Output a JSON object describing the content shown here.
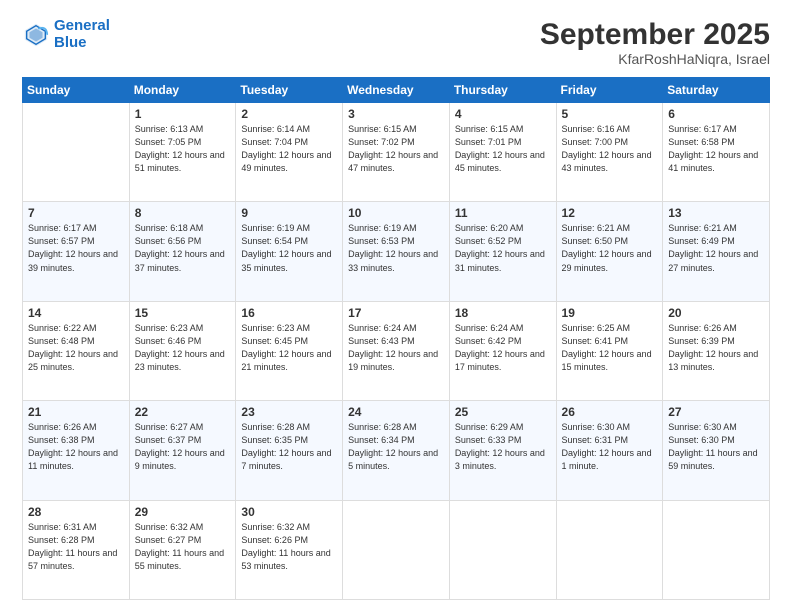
{
  "header": {
    "logo_line1": "General",
    "logo_line2": "Blue",
    "month": "September 2025",
    "location": "KfarRoshHaNiqra, Israel"
  },
  "weekdays": [
    "Sunday",
    "Monday",
    "Tuesday",
    "Wednesday",
    "Thursday",
    "Friday",
    "Saturday"
  ],
  "weeks": [
    [
      {
        "day": "",
        "sunrise": "",
        "sunset": "",
        "daylight": ""
      },
      {
        "day": "1",
        "sunrise": "Sunrise: 6:13 AM",
        "sunset": "Sunset: 7:05 PM",
        "daylight": "Daylight: 12 hours and 51 minutes."
      },
      {
        "day": "2",
        "sunrise": "Sunrise: 6:14 AM",
        "sunset": "Sunset: 7:04 PM",
        "daylight": "Daylight: 12 hours and 49 minutes."
      },
      {
        "day": "3",
        "sunrise": "Sunrise: 6:15 AM",
        "sunset": "Sunset: 7:02 PM",
        "daylight": "Daylight: 12 hours and 47 minutes."
      },
      {
        "day": "4",
        "sunrise": "Sunrise: 6:15 AM",
        "sunset": "Sunset: 7:01 PM",
        "daylight": "Daylight: 12 hours and 45 minutes."
      },
      {
        "day": "5",
        "sunrise": "Sunrise: 6:16 AM",
        "sunset": "Sunset: 7:00 PM",
        "daylight": "Daylight: 12 hours and 43 minutes."
      },
      {
        "day": "6",
        "sunrise": "Sunrise: 6:17 AM",
        "sunset": "Sunset: 6:58 PM",
        "daylight": "Daylight: 12 hours and 41 minutes."
      }
    ],
    [
      {
        "day": "7",
        "sunrise": "Sunrise: 6:17 AM",
        "sunset": "Sunset: 6:57 PM",
        "daylight": "Daylight: 12 hours and 39 minutes."
      },
      {
        "day": "8",
        "sunrise": "Sunrise: 6:18 AM",
        "sunset": "Sunset: 6:56 PM",
        "daylight": "Daylight: 12 hours and 37 minutes."
      },
      {
        "day": "9",
        "sunrise": "Sunrise: 6:19 AM",
        "sunset": "Sunset: 6:54 PM",
        "daylight": "Daylight: 12 hours and 35 minutes."
      },
      {
        "day": "10",
        "sunrise": "Sunrise: 6:19 AM",
        "sunset": "Sunset: 6:53 PM",
        "daylight": "Daylight: 12 hours and 33 minutes."
      },
      {
        "day": "11",
        "sunrise": "Sunrise: 6:20 AM",
        "sunset": "Sunset: 6:52 PM",
        "daylight": "Daylight: 12 hours and 31 minutes."
      },
      {
        "day": "12",
        "sunrise": "Sunrise: 6:21 AM",
        "sunset": "Sunset: 6:50 PM",
        "daylight": "Daylight: 12 hours and 29 minutes."
      },
      {
        "day": "13",
        "sunrise": "Sunrise: 6:21 AM",
        "sunset": "Sunset: 6:49 PM",
        "daylight": "Daylight: 12 hours and 27 minutes."
      }
    ],
    [
      {
        "day": "14",
        "sunrise": "Sunrise: 6:22 AM",
        "sunset": "Sunset: 6:48 PM",
        "daylight": "Daylight: 12 hours and 25 minutes."
      },
      {
        "day": "15",
        "sunrise": "Sunrise: 6:23 AM",
        "sunset": "Sunset: 6:46 PM",
        "daylight": "Daylight: 12 hours and 23 minutes."
      },
      {
        "day": "16",
        "sunrise": "Sunrise: 6:23 AM",
        "sunset": "Sunset: 6:45 PM",
        "daylight": "Daylight: 12 hours and 21 minutes."
      },
      {
        "day": "17",
        "sunrise": "Sunrise: 6:24 AM",
        "sunset": "Sunset: 6:43 PM",
        "daylight": "Daylight: 12 hours and 19 minutes."
      },
      {
        "day": "18",
        "sunrise": "Sunrise: 6:24 AM",
        "sunset": "Sunset: 6:42 PM",
        "daylight": "Daylight: 12 hours and 17 minutes."
      },
      {
        "day": "19",
        "sunrise": "Sunrise: 6:25 AM",
        "sunset": "Sunset: 6:41 PM",
        "daylight": "Daylight: 12 hours and 15 minutes."
      },
      {
        "day": "20",
        "sunrise": "Sunrise: 6:26 AM",
        "sunset": "Sunset: 6:39 PM",
        "daylight": "Daylight: 12 hours and 13 minutes."
      }
    ],
    [
      {
        "day": "21",
        "sunrise": "Sunrise: 6:26 AM",
        "sunset": "Sunset: 6:38 PM",
        "daylight": "Daylight: 12 hours and 11 minutes."
      },
      {
        "day": "22",
        "sunrise": "Sunrise: 6:27 AM",
        "sunset": "Sunset: 6:37 PM",
        "daylight": "Daylight: 12 hours and 9 minutes."
      },
      {
        "day": "23",
        "sunrise": "Sunrise: 6:28 AM",
        "sunset": "Sunset: 6:35 PM",
        "daylight": "Daylight: 12 hours and 7 minutes."
      },
      {
        "day": "24",
        "sunrise": "Sunrise: 6:28 AM",
        "sunset": "Sunset: 6:34 PM",
        "daylight": "Daylight: 12 hours and 5 minutes."
      },
      {
        "day": "25",
        "sunrise": "Sunrise: 6:29 AM",
        "sunset": "Sunset: 6:33 PM",
        "daylight": "Daylight: 12 hours and 3 minutes."
      },
      {
        "day": "26",
        "sunrise": "Sunrise: 6:30 AM",
        "sunset": "Sunset: 6:31 PM",
        "daylight": "Daylight: 12 hours and 1 minute."
      },
      {
        "day": "27",
        "sunrise": "Sunrise: 6:30 AM",
        "sunset": "Sunset: 6:30 PM",
        "daylight": "Daylight: 11 hours and 59 minutes."
      }
    ],
    [
      {
        "day": "28",
        "sunrise": "Sunrise: 6:31 AM",
        "sunset": "Sunset: 6:28 PM",
        "daylight": "Daylight: 11 hours and 57 minutes."
      },
      {
        "day": "29",
        "sunrise": "Sunrise: 6:32 AM",
        "sunset": "Sunset: 6:27 PM",
        "daylight": "Daylight: 11 hours and 55 minutes."
      },
      {
        "day": "30",
        "sunrise": "Sunrise: 6:32 AM",
        "sunset": "Sunset: 6:26 PM",
        "daylight": "Daylight: 11 hours and 53 minutes."
      },
      {
        "day": "",
        "sunrise": "",
        "sunset": "",
        "daylight": ""
      },
      {
        "day": "",
        "sunrise": "",
        "sunset": "",
        "daylight": ""
      },
      {
        "day": "",
        "sunrise": "",
        "sunset": "",
        "daylight": ""
      },
      {
        "day": "",
        "sunrise": "",
        "sunset": "",
        "daylight": ""
      }
    ]
  ]
}
